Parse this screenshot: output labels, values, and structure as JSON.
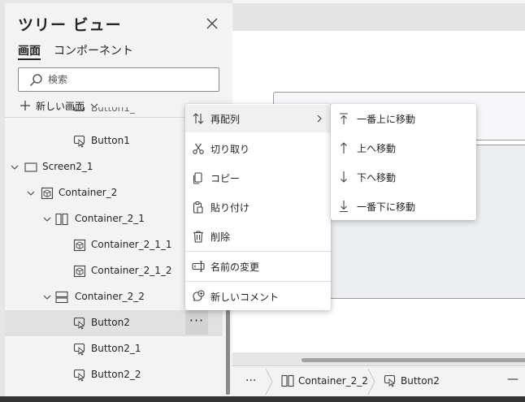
{
  "panel": {
    "title": "ツリー ビュー",
    "tabs": [
      "画面",
      "コンポーネント"
    ],
    "search_placeholder": "検索",
    "new_screen_label": "新しい画面"
  },
  "tree": {
    "partial_item": "Button1_",
    "items": [
      {
        "label": "Button1",
        "icon": "button-icon"
      },
      {
        "label": "Screen2_1",
        "icon": "screen-icon"
      },
      {
        "label": "Container_2",
        "icon": "container-icon"
      },
      {
        "label": "Container_2_1",
        "icon": "horizontal-container-icon"
      },
      {
        "label": "Container_2_1_1",
        "icon": "container-icon"
      },
      {
        "label": "Container_2_1_2",
        "icon": "container-icon"
      },
      {
        "label": "Container_2_2",
        "icon": "vertical-container-icon"
      },
      {
        "label": "Button2",
        "icon": "button-icon",
        "selected": true
      },
      {
        "label": "Button2_1",
        "icon": "button-icon"
      },
      {
        "label": "Button2_2",
        "icon": "button-icon"
      }
    ],
    "more_label": "···"
  },
  "context_menu": {
    "items": [
      {
        "label": "再配列",
        "icon": "reorder-icon"
      },
      {
        "label": "切り取り",
        "icon": "cut-icon"
      },
      {
        "label": "コピー",
        "icon": "copy-icon"
      },
      {
        "label": "貼り付け",
        "icon": "paste-icon"
      },
      {
        "label": "削除",
        "icon": "delete-icon"
      },
      {
        "label": "名前の変更",
        "icon": "rename-icon"
      },
      {
        "label": "新しいコメント",
        "icon": "comment-add-icon"
      }
    ]
  },
  "submenu": {
    "items": [
      {
        "label": "一番上に移動",
        "icon": "move-to-top-icon"
      },
      {
        "label": "上へ移動",
        "icon": "move-up-icon"
      },
      {
        "label": "下へ移動",
        "icon": "move-down-icon"
      },
      {
        "label": "一番下に移動",
        "icon": "move-to-bottom-icon"
      }
    ]
  },
  "breadcrumb": {
    "more": "···",
    "items": [
      {
        "label": "Container_2_2",
        "icon": "horizontal-container-icon"
      },
      {
        "label": "Button2",
        "icon": "button-icon"
      }
    ],
    "minus": "—"
  },
  "colors": {
    "accent": "#742774",
    "panel_bg": "#f3f3f3",
    "selected_row": "#e1e1e1"
  }
}
